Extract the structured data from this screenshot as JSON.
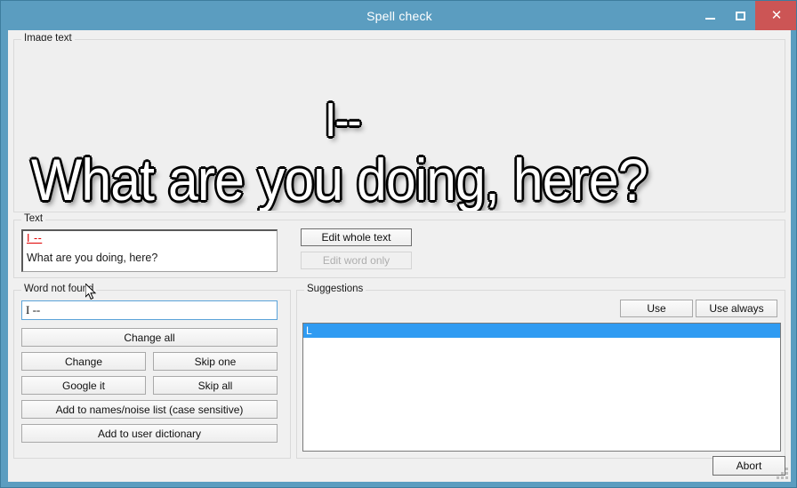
{
  "window": {
    "title": "Spell check",
    "title_bar_color": "#5b9dc0",
    "close_button_color": "#cc5555",
    "caption": {
      "minimize_label": "–",
      "maximize_label": "□",
      "close_label": "✕",
      "minimize_icon": "minimize-icon",
      "maximize_icon": "maximize-icon",
      "close_icon": "close-icon"
    }
  },
  "image_text": {
    "group_label": "Image text",
    "line1": "I--",
    "line2": "What are you doing, here?"
  },
  "text_group": {
    "group_label": "Text",
    "misspelled_word": "I --",
    "misspelled_color": "#e00000",
    "sentence": "What are you doing, here?",
    "edit_whole_text_label": "Edit whole text",
    "edit_word_only_label": "Edit word only",
    "edit_word_only_enabled": false
  },
  "word_not_found": {
    "group_label": "Word not found",
    "input_value": "I --",
    "input_placeholder": "",
    "buttons": {
      "change_all": "Change all",
      "change": "Change",
      "skip_one": "Skip one",
      "google_it": "Google it",
      "skip_all": "Skip all",
      "add_names_noise": "Add to names/noise list (case sensitive)",
      "add_user_dictionary": "Add to user dictionary"
    }
  },
  "suggestions": {
    "group_label": "Suggestions",
    "use_label": "Use",
    "use_always_label": "Use always",
    "selection_color": "#2f9bf2",
    "items": [
      {
        "label": "L",
        "selected": true
      }
    ]
  },
  "footer": {
    "abort_label": "Abort"
  }
}
